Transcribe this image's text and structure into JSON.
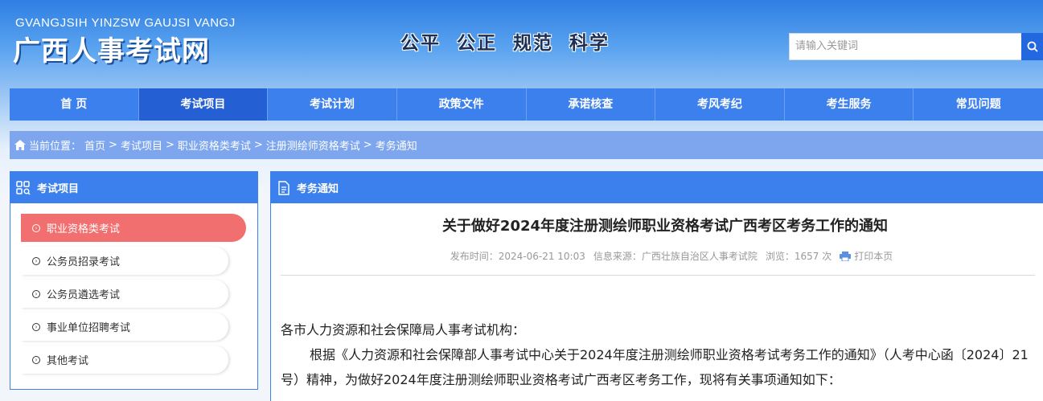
{
  "header": {
    "logo_sub": "GVANGJSIH YINZSW GAUJSI VANGJ",
    "logo_main": "广西人事考试网",
    "slogan": "公平  公正  规范  科学",
    "search_placeholder": "请输入关键词"
  },
  "nav": {
    "items": [
      "首 页",
      "考试项目",
      "考试计划",
      "政策文件",
      "承诺核查",
      "考风考纪",
      "考生服务",
      "常见问题"
    ]
  },
  "breadcrumb": {
    "label": "当前位置：",
    "items": [
      "首页",
      ">",
      "考试项目",
      ">",
      "职业资格类考试",
      ">",
      "注册测绘师资格考试",
      ">",
      "考务通知"
    ]
  },
  "sidebar": {
    "title": "考试项目",
    "items": [
      "职业资格类考试",
      "公务员招录考试",
      "公务员遴选考试",
      "事业单位招聘考试",
      "其他考试"
    ]
  },
  "main": {
    "panel_title": "考务通知",
    "article_title": "关于做好2024年度注册测绘师职业资格考试广西考区考务工作的通知",
    "publish_time": "发布时间：2024-06-21 10:03",
    "source": "信息来源：广西壮族自治区人事考试院",
    "views": "浏览：1657 次",
    "print_label": "打印本页",
    "salutation": "各市人力资源和社会保障局人事考试机构：",
    "paragraph1": "根据《人力资源和社会保障部人事考试中心关于2024年度注册测绘师职业资格考试考务工作的通知》（人考中心函〔2024〕21号）精神，为做好2024年度注册测绘师职业资格考试广西考区考务工作，现将有关事项通知如下："
  },
  "colors": {
    "nav_bg": "#3c80ee",
    "nav_active": "#245fd4",
    "sidebar_active": "#f26f6f"
  }
}
